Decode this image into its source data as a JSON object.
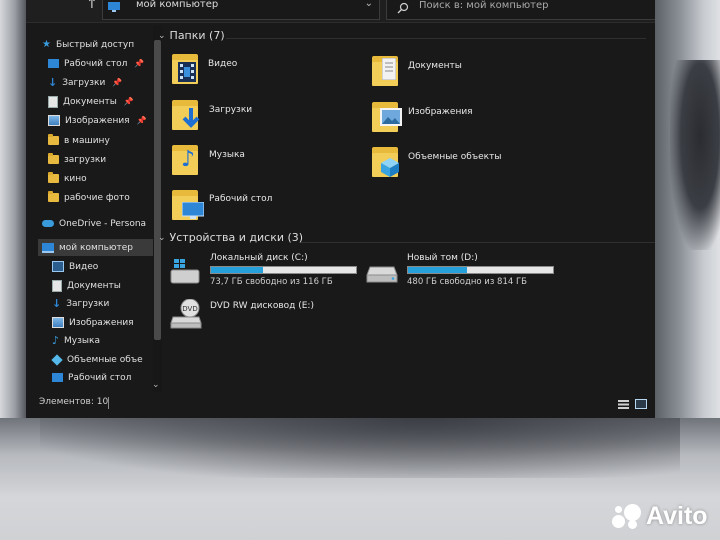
{
  "window": {
    "address": "мой компьютер",
    "search_placeholder": "Поиск в: мой компьютер"
  },
  "sidebar": {
    "items": [
      {
        "label": "Быстрый доступ",
        "icon": "star-icon",
        "pinned": false
      },
      {
        "label": "Рабочий стол",
        "icon": "desktop-icon",
        "pinned": true
      },
      {
        "label": "Загрузки",
        "icon": "download-icon",
        "pinned": true
      },
      {
        "label": "Документы",
        "icon": "documents-icon",
        "pinned": true
      },
      {
        "label": "Изображения",
        "icon": "pictures-icon",
        "pinned": true
      },
      {
        "label": "в машину",
        "icon": "folder-icon",
        "pinned": false
      },
      {
        "label": "загрузки",
        "icon": "folder-icon",
        "pinned": false
      },
      {
        "label": "кино",
        "icon": "folder-icon",
        "pinned": false
      },
      {
        "label": "рабочие фото",
        "icon": "folder-icon",
        "pinned": false
      },
      {
        "label": "OneDrive - Persona",
        "icon": "cloud-icon",
        "pinned": false
      },
      {
        "label": "мой компьютер",
        "icon": "computer-icon",
        "pinned": false,
        "selected": true
      },
      {
        "label": "Видео",
        "icon": "video-icon",
        "pinned": false
      },
      {
        "label": "Документы",
        "icon": "documents-icon",
        "pinned": false
      },
      {
        "label": "Загрузки",
        "icon": "download-icon",
        "pinned": false
      },
      {
        "label": "Изображения",
        "icon": "pictures-icon",
        "pinned": false
      },
      {
        "label": "Музыка",
        "icon": "music-icon",
        "pinned": false
      },
      {
        "label": "Объемные объе",
        "icon": "3d-objects-icon",
        "pinned": false
      },
      {
        "label": "Рабочий стол",
        "icon": "desktop-icon",
        "pinned": false
      }
    ]
  },
  "folders": {
    "header": "Папки (7)",
    "items": [
      {
        "label": "Видео",
        "icon": "video-folder-icon"
      },
      {
        "label": "Документы",
        "icon": "documents-folder-icon"
      },
      {
        "label": "Загрузки",
        "icon": "downloads-folder-icon"
      },
      {
        "label": "Изображения",
        "icon": "pictures-folder-icon"
      },
      {
        "label": "Музыка",
        "icon": "music-folder-icon"
      },
      {
        "label": "Объемные объекты",
        "icon": "3d-objects-folder-icon"
      },
      {
        "label": "Рабочий стол",
        "icon": "desktop-folder-icon"
      }
    ]
  },
  "devices": {
    "header": "Устройства и диски (3)",
    "items": [
      {
        "name": "Локальный диск (C:)",
        "free": "73,7 ГБ свободно из 116 ГБ",
        "used_fraction": 0.36,
        "icon": "windows-drive-icon"
      },
      {
        "name": "Новый том (D:)",
        "free": "480 ГБ свободно из 814 ГБ",
        "used_fraction": 0.41,
        "icon": "hard-drive-icon"
      },
      {
        "name": "DVD RW дисковод (E:)",
        "icon": "dvd-drive-icon"
      }
    ]
  },
  "status": {
    "items_count": "Элементов: 10"
  },
  "watermark": {
    "text": "Avito"
  }
}
